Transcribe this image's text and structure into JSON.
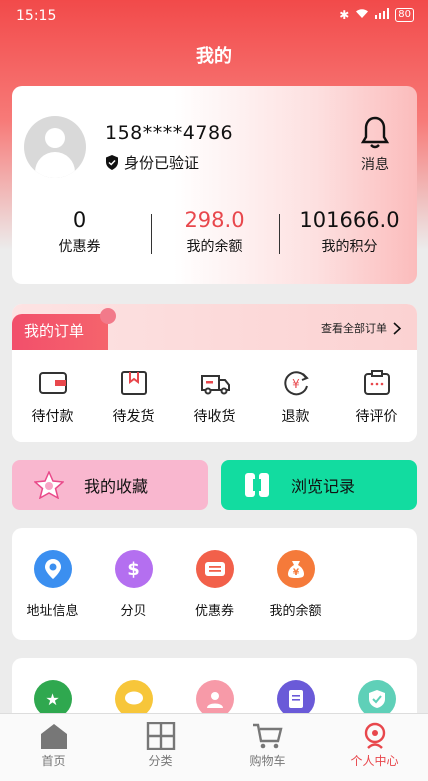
{
  "status_bar": {
    "time": "15:15",
    "battery": "80"
  },
  "page": {
    "title": "我的"
  },
  "profile": {
    "phone": "158****4786",
    "verified_label": "身份已验证",
    "message_label": "消息"
  },
  "stats": [
    {
      "value": "0",
      "label": "优惠券"
    },
    {
      "value": "298.0",
      "label": "我的余额"
    },
    {
      "value": "101666.0",
      "label": "我的积分"
    }
  ],
  "orders": {
    "title": "我的订单",
    "view_all": "查看全部订单",
    "items": [
      {
        "label": "待付款",
        "icon": "wallet-icon"
      },
      {
        "label": "待发货",
        "icon": "package-icon"
      },
      {
        "label": "待收货",
        "icon": "truck-icon"
      },
      {
        "label": "退款",
        "icon": "refund-icon"
      },
      {
        "label": "待评价",
        "icon": "review-icon"
      }
    ]
  },
  "shortcuts": {
    "favorites": "我的收藏",
    "history": "浏览记录"
  },
  "services": [
    {
      "label": "地址信息",
      "icon": "location-icon",
      "color": "#3b8ff0"
    },
    {
      "label": "分贝",
      "icon": "dollar-icon",
      "color": "#b46ff0"
    },
    {
      "label": "优惠券",
      "icon": "coupon-icon",
      "color": "#f2604a"
    },
    {
      "label": "我的余额",
      "icon": "money-bag-icon",
      "color": "#f57a3a"
    }
  ],
  "tabbar": [
    {
      "label": "首页",
      "icon": "home-icon"
    },
    {
      "label": "分类",
      "icon": "grid-icon"
    },
    {
      "label": "购物车",
      "icon": "cart-icon"
    },
    {
      "label": "个人中心",
      "icon": "user-icon"
    }
  ],
  "colors": {
    "accent": "#e8474c",
    "favorites_bg": "#f9b7cf",
    "history_bg": "#12dca0"
  }
}
